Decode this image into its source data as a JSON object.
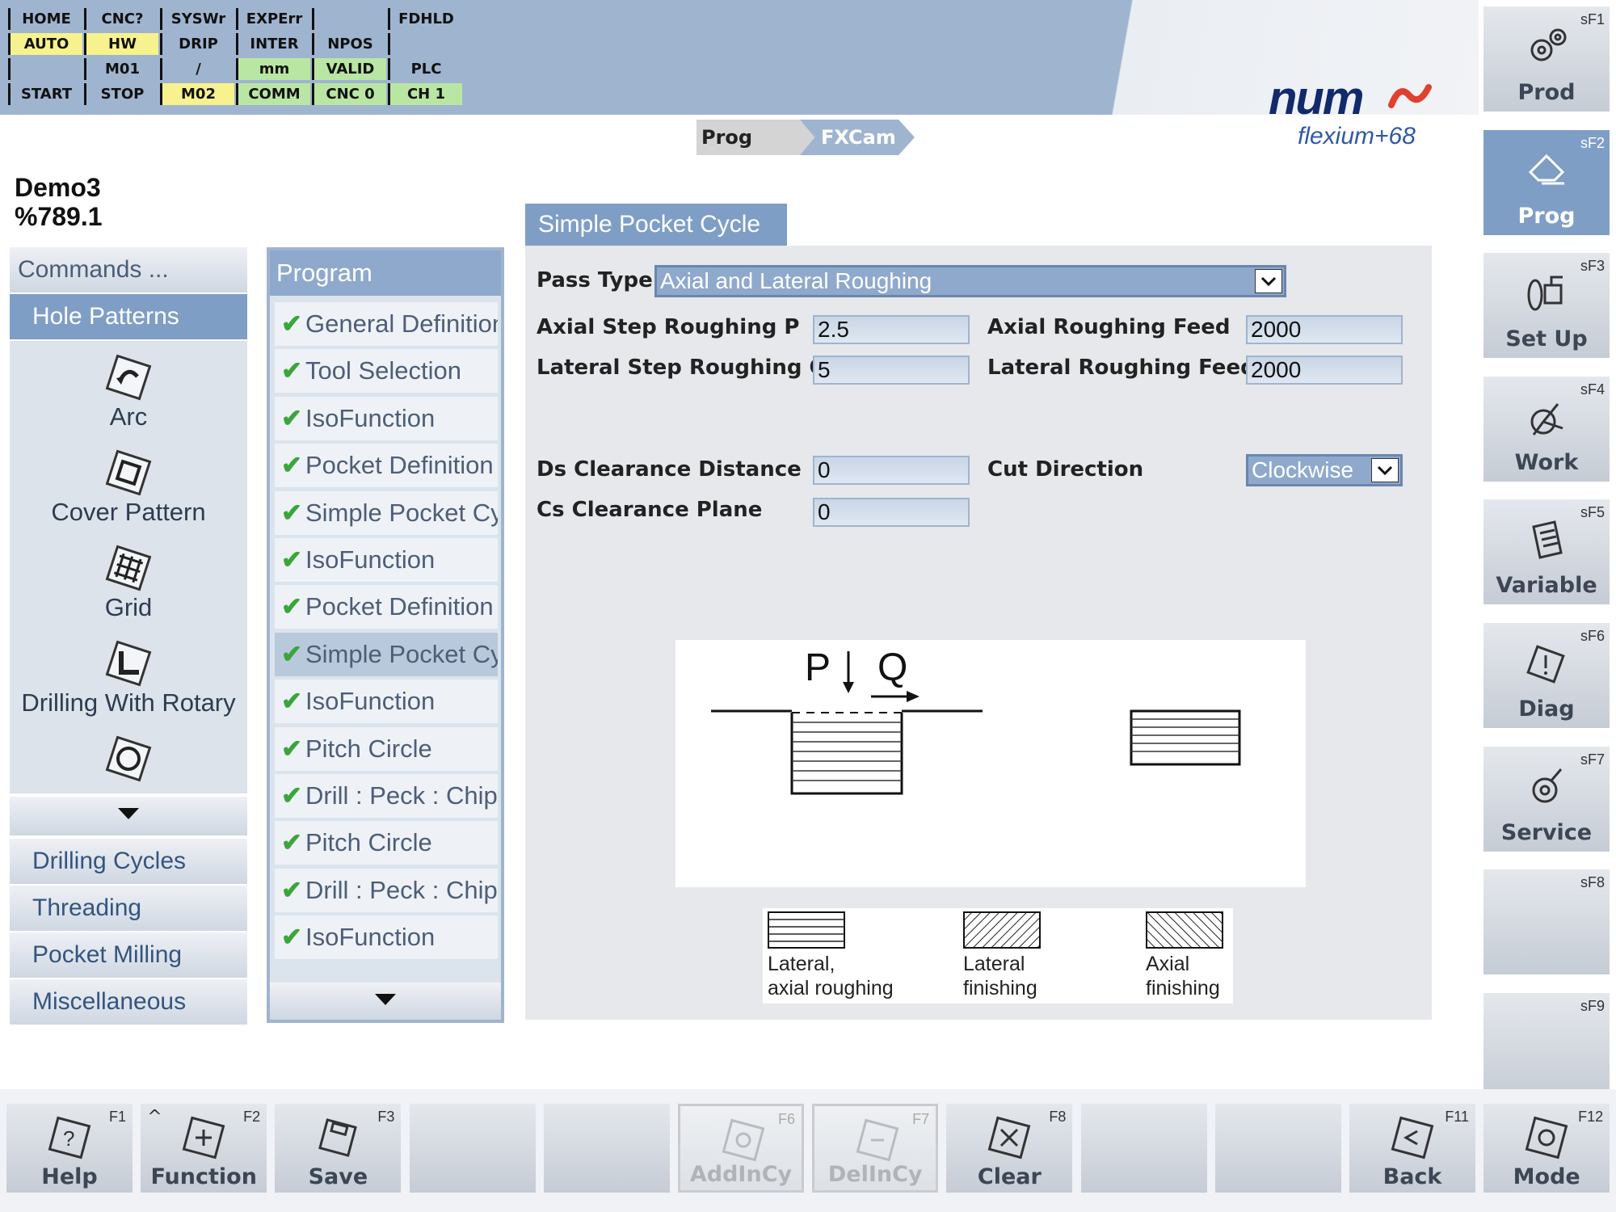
{
  "status": {
    "cells": [
      [
        "HOME",
        "CNC?",
        "SYSWr",
        "EXPErr",
        "",
        "FDHLD"
      ],
      [
        "AUTO",
        "HW",
        "DRIP",
        "INTER",
        "NPOS",
        ""
      ],
      [
        "",
        "M01",
        "/",
        "mm",
        "VALID",
        "PLC"
      ],
      [
        "START",
        "STOP",
        "M02",
        "COMM",
        "CNC 0",
        "CH 1"
      ]
    ],
    "colors": [
      [
        "",
        "",
        "",
        "",
        "",
        ""
      ],
      [
        "yellow",
        "yellow",
        "",
        "",
        "",
        ""
      ],
      [
        "",
        "",
        "",
        "green",
        "green",
        ""
      ],
      [
        "",
        "",
        "yellow",
        "green",
        "green",
        "green"
      ]
    ]
  },
  "logo": {
    "brand": "num",
    "sub": "flexium+68"
  },
  "breadcrumb": {
    "prog": "Prog",
    "fxcam": "FXCam"
  },
  "program_info": {
    "name": "Demo3",
    "number": "%789.1"
  },
  "commands": {
    "title": "Commands ...",
    "active_category": "Hole Patterns",
    "patterns": [
      "Arc",
      "Cover Pattern",
      "Grid",
      "Drilling With Rotary"
    ],
    "categories": [
      "Drilling Cycles",
      "Threading",
      "Pocket Milling",
      "Miscellaneous"
    ]
  },
  "program": {
    "title": "Program",
    "items": [
      "General Definition",
      "Tool Selection",
      "IsoFunction",
      "Pocket Definition",
      "Simple Pocket Cycle",
      "IsoFunction",
      "Pocket Definition",
      "Simple Pocket Cycle",
      "IsoFunction",
      "Pitch Circle",
      "Drill : Peck : Chip",
      "Pitch Circle",
      "Drill : Peck : Chip",
      "IsoFunction"
    ],
    "selected_index": 7
  },
  "form": {
    "title": "Simple Pocket Cycle",
    "pass_type_label": "Pass Type",
    "pass_type_value": "Axial and Lateral Roughing",
    "axial_step_label": "Axial Step Roughing P",
    "axial_step_value": "2.5",
    "axial_feed_label": "Axial Roughing Feed",
    "axial_feed_value": "2000",
    "lateral_step_label": "Lateral Step Roughing Q",
    "lateral_step_value": "5",
    "lateral_feed_label": "Lateral Roughing Feed",
    "lateral_feed_value": "2000",
    "ds_label": "Ds Clearance Distance",
    "ds_value": "0",
    "cut_direction_label": "Cut Direction",
    "cut_direction_value": "Clockwise",
    "cs_label": "Cs Clearance Plane",
    "cs_value": "0"
  },
  "diagram": {
    "p": "P",
    "q": "Q"
  },
  "legend": {
    "lateral_axial_roughing": [
      "Lateral,",
      "axial roughing"
    ],
    "lateral_finishing": [
      "Lateral",
      "finishing"
    ],
    "axial_finishing": [
      "Axial",
      "finishing"
    ]
  },
  "softkeys": [
    {
      "code": "sF1",
      "label": "Prod",
      "icon": "gears-icon",
      "active": false
    },
    {
      "code": "sF2",
      "label": "Prog",
      "icon": "hand-edit-icon",
      "active": true
    },
    {
      "code": "sF3",
      "label": "Set Up",
      "icon": "tool-setup-icon",
      "active": false
    },
    {
      "code": "sF4",
      "label": "Work",
      "icon": "work-icon",
      "active": false
    },
    {
      "code": "sF5",
      "label": "Variable",
      "icon": "document-icon",
      "active": false
    },
    {
      "code": "sF6",
      "label": "Diag",
      "icon": "warning-icon",
      "active": false
    },
    {
      "code": "sF7",
      "label": "Service",
      "icon": "service-icon",
      "active": false
    },
    {
      "code": "sF8",
      "label": "",
      "icon": "",
      "active": false
    },
    {
      "code": "sF9",
      "label": "",
      "icon": "",
      "active": false
    }
  ],
  "fkeys": [
    {
      "code": "F1",
      "label": "Help",
      "icon": "help-icon",
      "enabled": true
    },
    {
      "code": "F2",
      "label": "Function",
      "icon": "function-icon",
      "enabled": true,
      "caret": "^"
    },
    {
      "code": "F3",
      "label": "Save",
      "icon": "save-icon",
      "enabled": true
    },
    {
      "code": "",
      "label": "",
      "icon": "",
      "enabled": true
    },
    {
      "code": "",
      "label": "",
      "icon": "",
      "enabled": true
    },
    {
      "code": "F6",
      "label": "AddInCy",
      "icon": "add-cycle-icon",
      "enabled": false
    },
    {
      "code": "F7",
      "label": "DelInCy",
      "icon": "delete-cycle-icon",
      "enabled": false
    },
    {
      "code": "F8",
      "label": "Clear",
      "icon": "clear-icon",
      "enabled": true
    },
    {
      "code": "",
      "label": "",
      "icon": "",
      "enabled": true
    },
    {
      "code": "",
      "label": "",
      "icon": "",
      "enabled": true
    },
    {
      "code": "F11",
      "label": "Back",
      "icon": "back-icon",
      "enabled": true
    },
    {
      "code": "F12",
      "label": "Mode",
      "icon": "mode-icon",
      "enabled": true
    }
  ]
}
